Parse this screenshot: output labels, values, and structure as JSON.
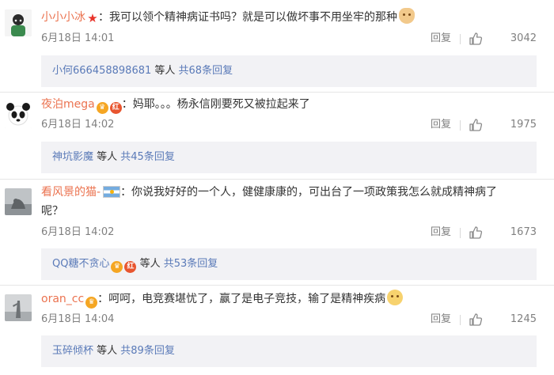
{
  "comments": [
    {
      "username": "小小小冰",
      "text": "：我可以领个精神病证书吗？就是可以做坏事不用坐牢的那种",
      "time": "6月18日 14:01",
      "reply_label": "回复",
      "likes": "3042",
      "sub": {
        "user": "小何666458898681",
        "middle": " 等人 ",
        "total": "共68条回复"
      }
    },
    {
      "username": "夜泊mega",
      "text": "：妈耶。。。杨永信刚要死又被拉起来了",
      "time": "6月18日 14:02",
      "reply_label": "回复",
      "likes": "1975",
      "sub": {
        "user": "神坑影魔",
        "middle": " 等人 ",
        "total": "共45条回复"
      }
    },
    {
      "username": "看风景的猫-",
      "text": "：你说我好好的一个人，健健康康的，可出台了一项政策我怎么就成精神病了",
      "text2": "呢？",
      "time": "6月18日 14:02",
      "reply_label": "回复",
      "likes": "1673",
      "sub": {
        "user": "QQ糖不贪心",
        "middle": " 等人 ",
        "total": "共53条回复"
      }
    },
    {
      "username": "oran_cc",
      "text": "：呵呵，电竞赛堪忧了，赢了是电子竞技，输了是精神疾病",
      "time": "6月18日 14:04",
      "reply_label": "回复",
      "likes": "1245",
      "sub": {
        "user": "玉碎倾杯",
        "middle": " 等人 ",
        "total": "共89条回复"
      }
    }
  ],
  "colors": {
    "username": "#eb7350",
    "link": "#5a7ab8",
    "meta": "#808080",
    "subreply_bg": "#f2f2f5"
  },
  "icons": [
    "star-badge-icon",
    "crown-badge-icon",
    "red-badge-icon",
    "argentina-flag-icon",
    "emoji-icon",
    "thumb-up-icon"
  ]
}
